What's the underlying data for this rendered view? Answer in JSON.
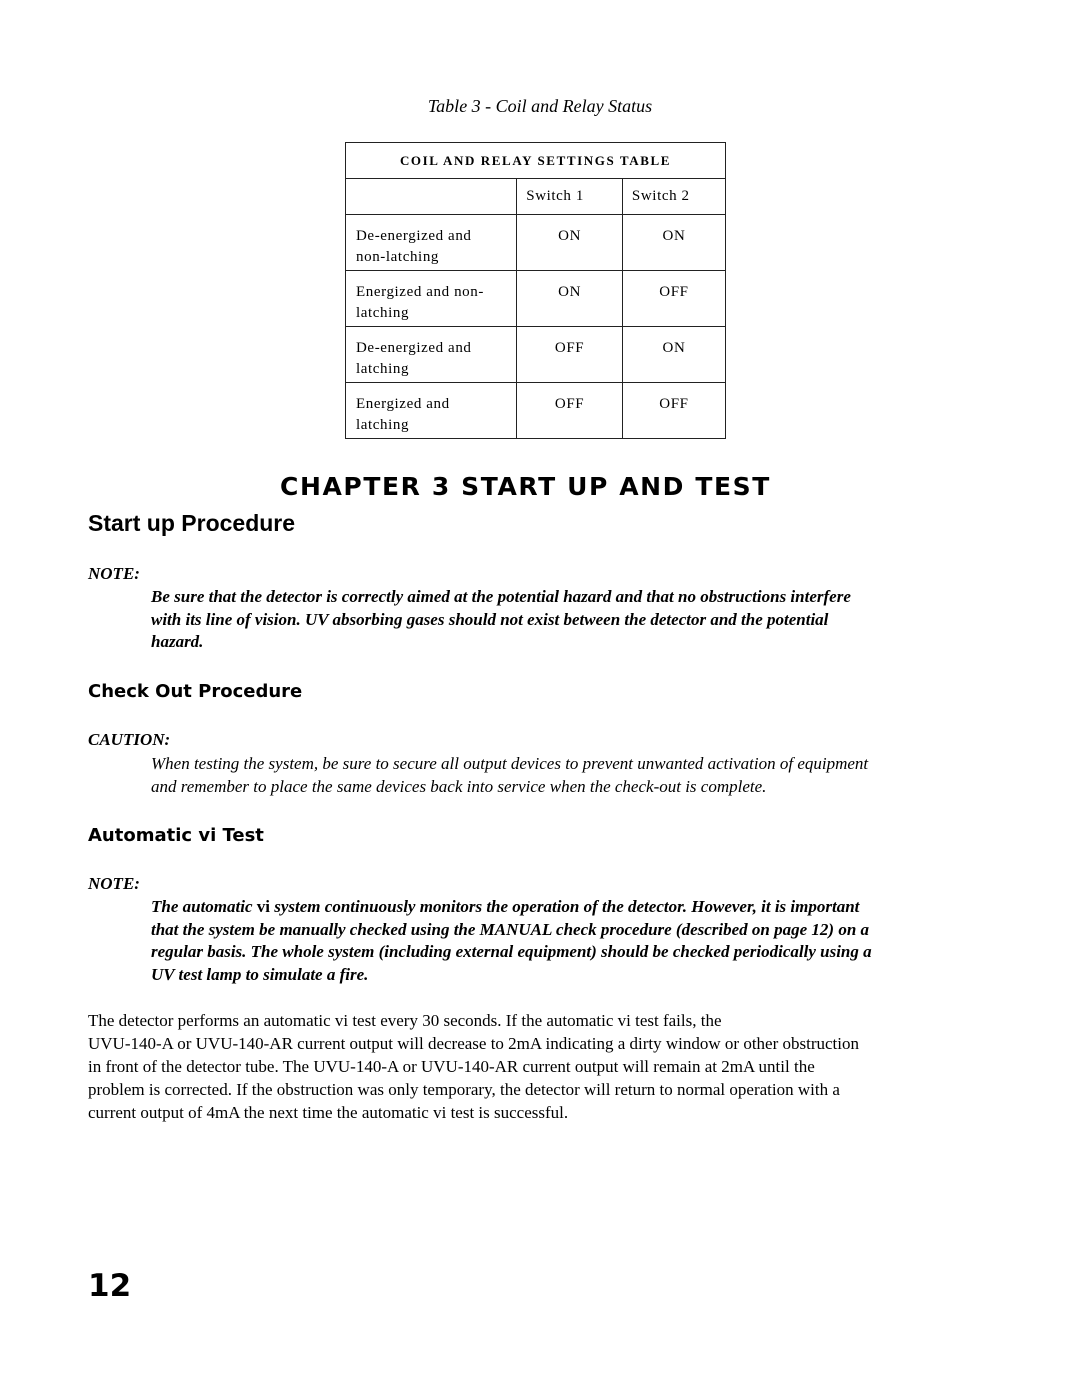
{
  "table": {
    "caption": "Table 3 - Coil and Relay Status",
    "title": "COIL AND RELAY SETTINGS TABLE",
    "columns": [
      "",
      "Switch 1",
      "Switch 2"
    ],
    "rows": [
      {
        "line1": "De-energized and",
        "line2": "non-latching",
        "switch1": "ON",
        "switch2": "ON"
      },
      {
        "line1": "Energized and non-",
        "line2": "latching",
        "switch1": "ON",
        "switch2": "OFF"
      },
      {
        "line1": "De-energized and",
        "line2": "latching",
        "switch1": "OFF",
        "switch2": "ON"
      },
      {
        "line1": "Energized and",
        "line2": "latching",
        "switch1": "OFF",
        "switch2": "OFF"
      }
    ]
  },
  "chapter_title": "CHAPTER 3 START UP AND TEST",
  "startup": {
    "heading": "Start up Procedure",
    "note_label": "NOTE:",
    "note_lines": [
      "Be sure that the detector is correctly aimed at the potential hazard and that no obstructions interfere",
      "with its line of vision. UV absorbing gases should not exist between the detector and the potential",
      "hazard."
    ]
  },
  "checkout": {
    "heading": "Check Out Procedure",
    "caution_label": "CAUTION:",
    "caution_lines": [
      "When testing the system, be sure to secure all output devices to prevent unwanted activation of equipment",
      "and remember to place the same devices back into service when the check-out is complete."
    ]
  },
  "autotest": {
    "heading": "Automatic vi Test",
    "note_label": "NOTE:",
    "note_line1_pre": "The automatic ",
    "note_line1_vi": "vi",
    "note_line1_post": " system continuously monitors the operation of the detector. However, it is important",
    "note_lines": [
      "that the system be manually checked using the MANUAL check procedure (described on page 12) on a",
      "regular basis. The whole system (including external equipment) should be checked periodically using a",
      "UV test lamp to simulate a fire."
    ],
    "paragraph_lines": [
      "The detector performs an automatic vi test every 30 seconds. If the automatic vi test fails, the",
      "UVU-140-A or UVU-140-AR current output will decrease to 2mA indicating a dirty window or other obstruction",
      "in front of the detector tube. The UVU-140-A or UVU-140-AR current output will remain at 2mA until the",
      "problem is corrected. If the obstruction was only temporary, the detector will return to normal operation with a",
      "current output of 4mA the next time the automatic vi test is successful."
    ]
  },
  "page_number": "12"
}
